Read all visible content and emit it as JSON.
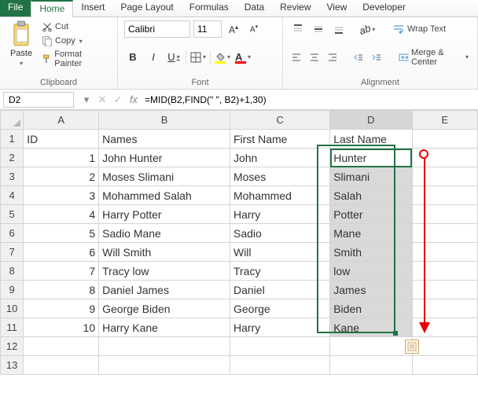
{
  "tabs": {
    "file": "File",
    "home": "Home",
    "insert": "Insert",
    "page": "Page Layout",
    "formulas": "Formulas",
    "data": "Data",
    "review": "Review",
    "view": "View",
    "developer": "Developer"
  },
  "clipboard": {
    "paste": "Paste",
    "cut": "Cut",
    "copy": "Copy",
    "fmt": "Format Painter",
    "title": "Clipboard"
  },
  "font": {
    "name": "Calibri",
    "size": "11",
    "title": "Font",
    "bold": "B",
    "italic": "I",
    "underline": "U"
  },
  "alignment": {
    "wrap": "Wrap Text",
    "merge": "Merge & Center",
    "title": "Alignment"
  },
  "fbar": {
    "name": "D2",
    "formula": "=MID(B2,FIND(\" \", B2)+1,30)",
    "fx": "fx"
  },
  "headers": {
    "A": "A",
    "B": "B",
    "C": "C",
    "D": "D",
    "E": "E"
  },
  "row1": {
    "A": "ID",
    "B": "Names",
    "C": "First Name",
    "D": "Last Name"
  },
  "data_rows": [
    {
      "n": "1",
      "id": "1",
      "name": "John Hunter",
      "first": "John",
      "last": "Hunter"
    },
    {
      "n": "2",
      "id": "2",
      "name": "Moses Slimani",
      "first": "Moses",
      "last": "Slimani"
    },
    {
      "n": "3",
      "id": "3",
      "name": "Mohammed Salah",
      "first": "Mohammed",
      "last": "Salah"
    },
    {
      "n": "4",
      "id": "4",
      "name": "Harry Potter",
      "first": "Harry",
      "last": "Potter"
    },
    {
      "n": "5",
      "id": "5",
      "name": "Sadio Mane",
      "first": "Sadio",
      "last": "Mane"
    },
    {
      "n": "6",
      "id": "6",
      "name": "Will Smith",
      "first": "Will",
      "last": "Smith"
    },
    {
      "n": "7",
      "id": "7",
      "name": "Tracy low",
      "first": "Tracy",
      "last": "low"
    },
    {
      "n": "8",
      "id": "8",
      "name": "Daniel James",
      "first": "Daniel",
      "last": "James"
    },
    {
      "n": "9",
      "id": "9",
      "name": "George Biden",
      "first": "George",
      "last": "Biden"
    },
    {
      "n": "10",
      "id": "10",
      "name": "Harry Kane",
      "first": "Harry",
      "last": "Kane"
    }
  ],
  "empty_rows": [
    "12",
    "13"
  ]
}
